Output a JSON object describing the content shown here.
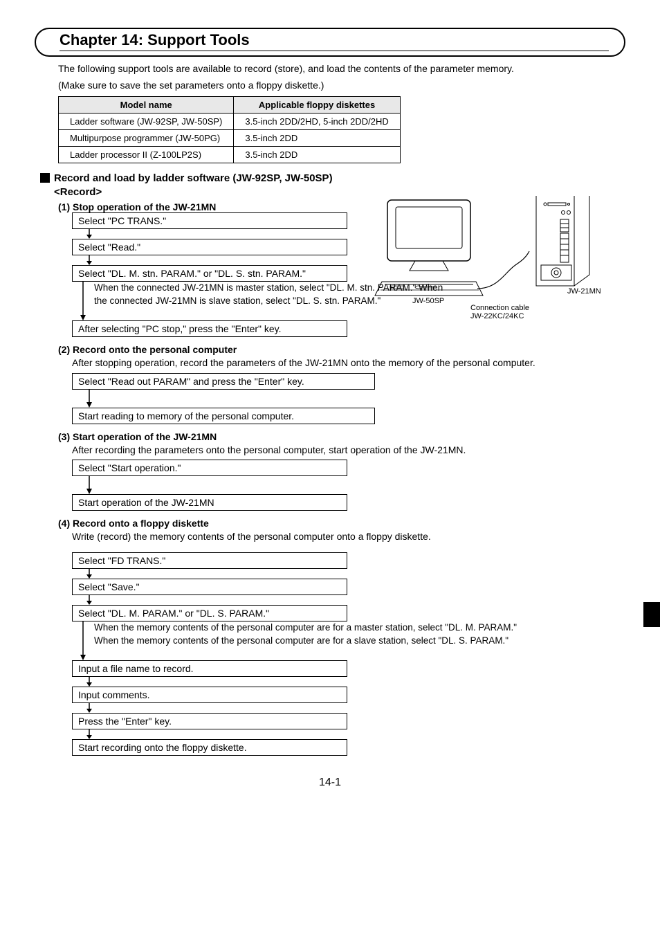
{
  "chapter_title": "Chapter 14: Support Tools",
  "intro_line1": "The following support tools are available to record (store), and load the contents of the parameter memory.",
  "intro_line2": "(Make sure to save the set parameters onto a floppy diskette.)",
  "model_table": {
    "headers": [
      "Model name",
      "Applicable floppy diskettes"
    ],
    "rows": [
      [
        "Ladder software (JW-92SP, JW-50SP)",
        "3.5-inch 2DD/2HD, 5-inch 2DD/2HD"
      ],
      [
        "Multipurpose programmer (JW-50PG)",
        "3.5-inch 2DD"
      ],
      [
        "Ladder processor II (Z-100LP2S)",
        "3.5-inch 2DD"
      ]
    ]
  },
  "section1_title": "Record and load by ladder software (JW-92SP, JW-50SP)",
  "section1_sub": "<Record>",
  "step1": {
    "head": "(1) Stop operation of the JW-21MN",
    "box1": "Select \"PC TRANS.\"",
    "box2": "Select \"Read.\"",
    "box3": "Select \"DL. M. stn. PARAM.\" or \"DL. S. stn. PARAM.\"",
    "note": "When the connected JW-21MN is master station, select \"DL. M. stn. PARAM.\" When the connected JW-21MN is slave station, select \"DL. S. stn. PARAM.\"",
    "box4": "After selecting \"PC stop,\" press the  \"Enter\" key."
  },
  "diagram": {
    "label_jw50sp": "JW-50SP",
    "label_jw21mn": "JW-21MN",
    "label_cable1": "Connection cable",
    "label_cable2": "JW-22KC/24KC"
  },
  "step2": {
    "head": "(2) Record onto the personal computer",
    "desc": "After stopping operation, record the parameters of the JW-21MN onto the memory of the personal computer.",
    "box1": "Select \"Read out PARAM\" and press the \"Enter\" key.",
    "box2": "Start reading to memory of the personal computer."
  },
  "step3": {
    "head": "(3) Start operation of the JW-21MN",
    "desc": "After recording the parameters onto the personal computer, start operation of the JW-21MN.",
    "box1": "Select \"Start operation.\"",
    "box2": "Start operation of the JW-21MN"
  },
  "step4": {
    "head": "(4) Record onto a floppy diskette",
    "desc": "Write (record) the memory contents of the personal computer onto a floppy diskette.",
    "box1": "Select \"FD TRANS.\"",
    "box2": "Select \"Save.\"",
    "box3": "Select \"DL. M. PARAM.\" or \"DL. S. PARAM.\"",
    "note": "When the memory contents of the personal computer are for a master station, select \"DL. M. PARAM.\" When the memory contents of the personal computer are for a slave station, select \"DL. S. PARAM.\"",
    "box4": "Input a file name to record.",
    "box5": "Input comments.",
    "box6": "Press the \"Enter\" key.",
    "box7": "Start recording onto the floppy diskette."
  },
  "page_number": "14-1"
}
